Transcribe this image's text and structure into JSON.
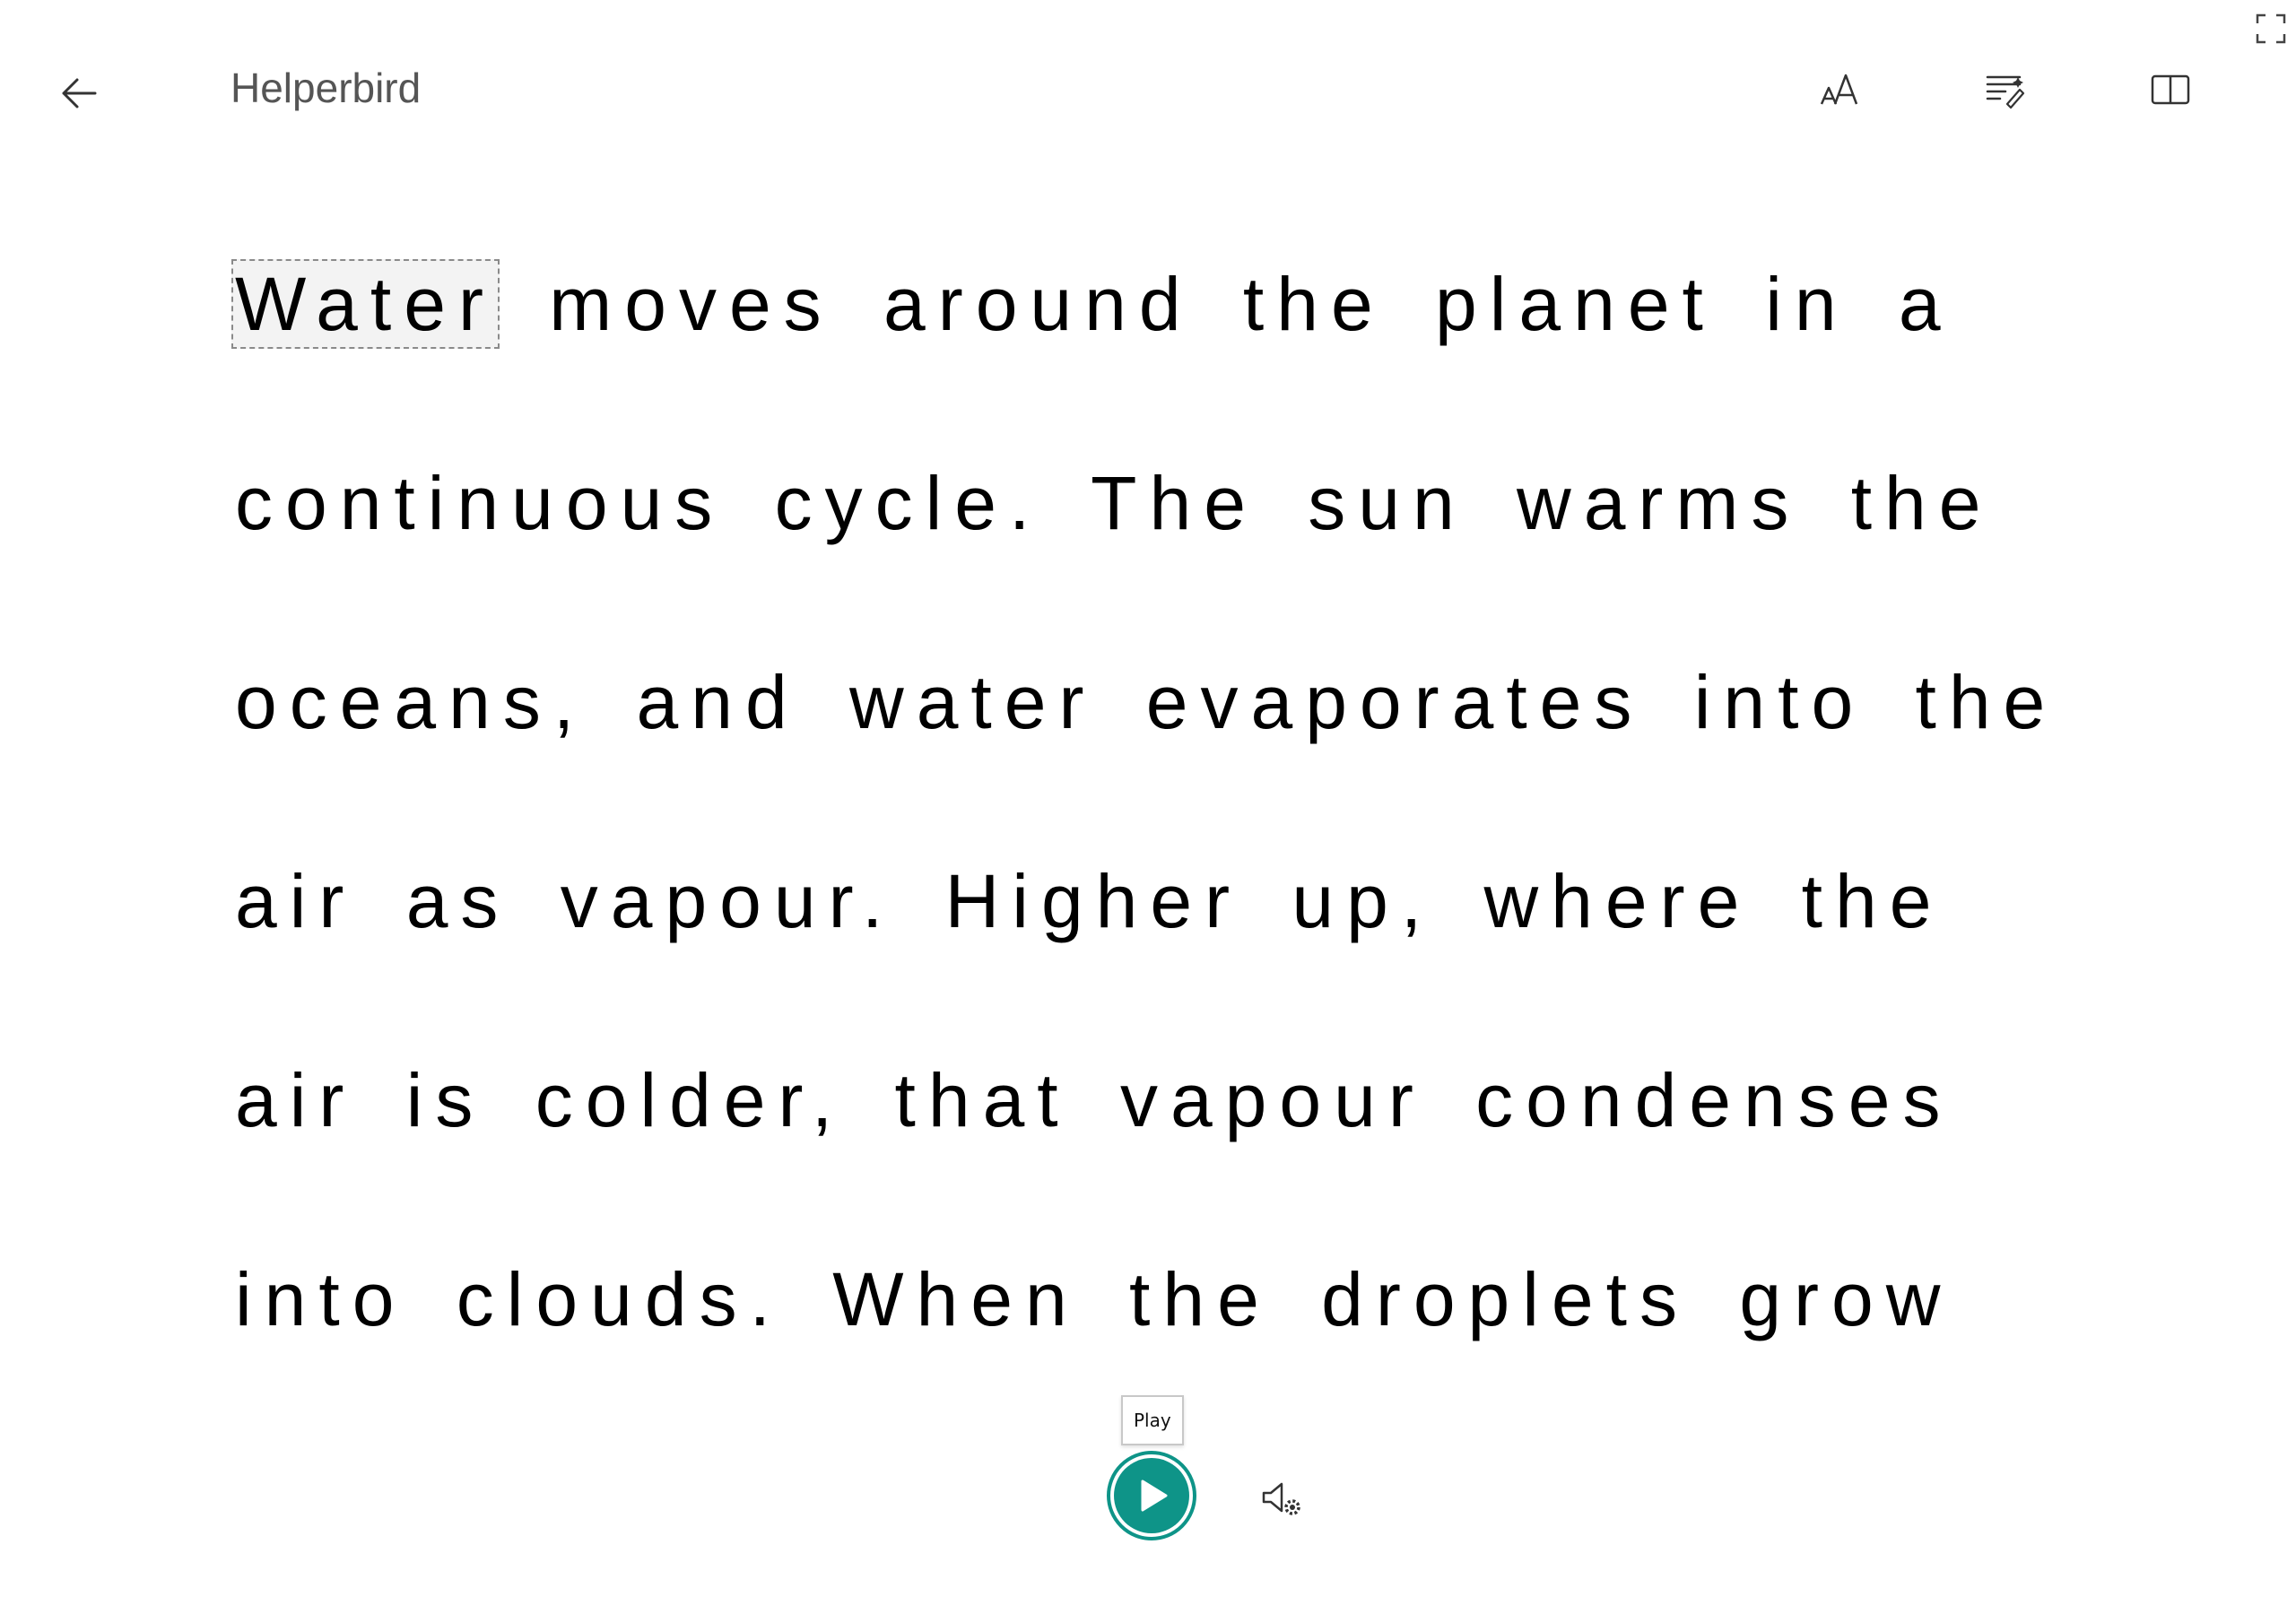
{
  "header": {
    "title": "Helperbird",
    "back_icon": "arrow-left-icon",
    "text_preferences_icon": "text-size-icon",
    "grammar_options_icon": "grammar-options-icon",
    "reading_preferences_icon": "book-open-icon",
    "fullscreen_icon": "fullscreen-icon"
  },
  "reader": {
    "focus_word": "Water",
    "lines": [
      " moves around the planet in a",
      "continuous cycle. The sun warms the",
      "oceans, and water evaporates into the",
      "air as vapour. Higher up, where the",
      "air is colder, that vapour condenses",
      "into clouds. When the droplets grow"
    ]
  },
  "controls": {
    "play_tooltip": "Play",
    "play_icon": "play-icon",
    "voice_settings_icon": "voice-settings-icon",
    "accent_color": "#0e9488"
  }
}
